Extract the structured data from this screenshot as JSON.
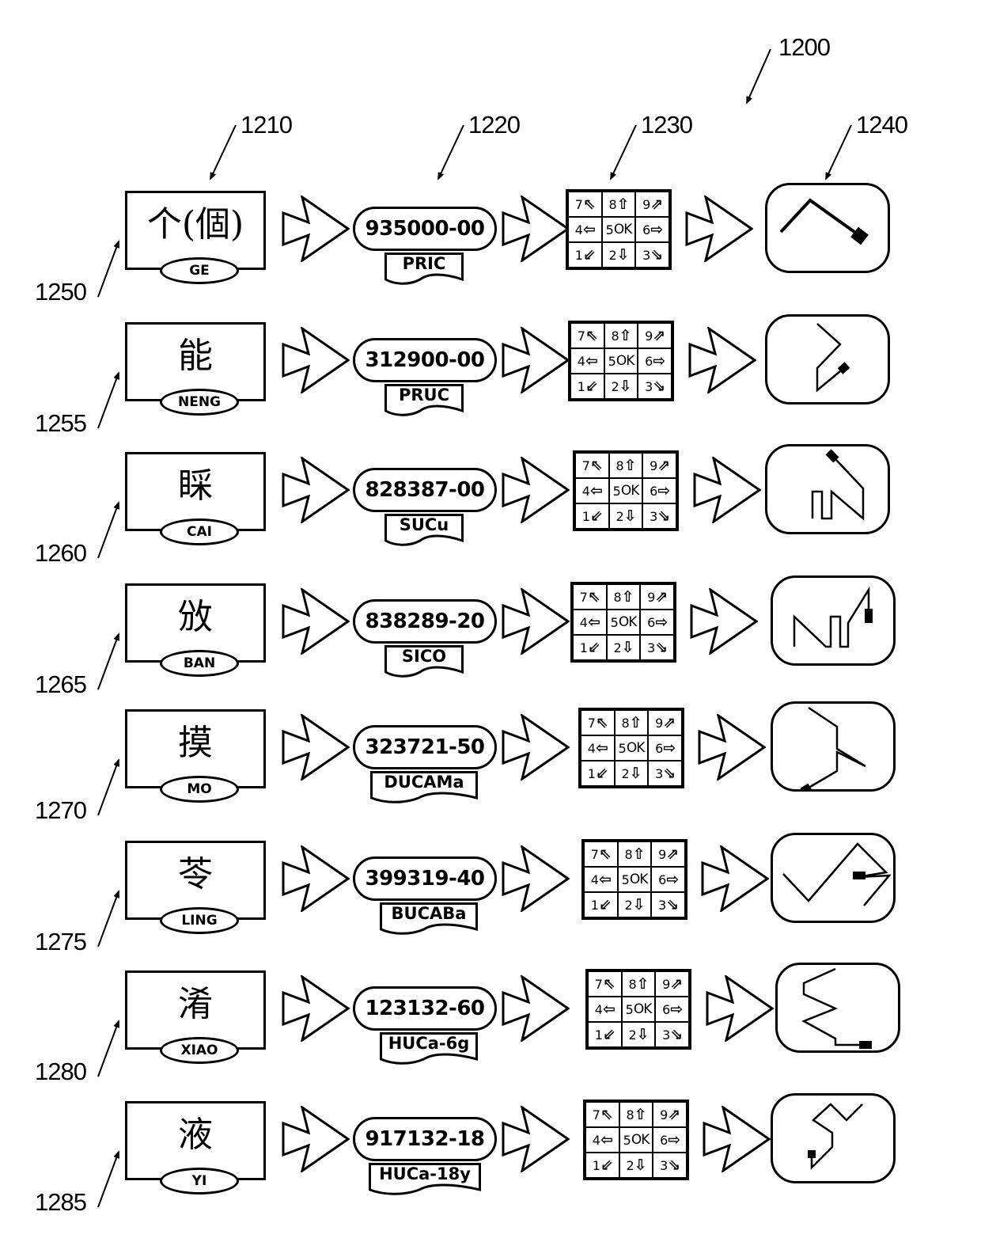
{
  "figure": {
    "ref": "1200",
    "column_refs": {
      "characters": "1210",
      "codes": "1220",
      "keypads": "1230",
      "gestures": "1240"
    }
  },
  "keypad_keys": [
    {
      "num": "7",
      "glyph": "⇖"
    },
    {
      "num": "8",
      "glyph": "⇧"
    },
    {
      "num": "9",
      "glyph": "⇗"
    },
    {
      "num": "4",
      "glyph": "⇦"
    },
    {
      "num": "5",
      "glyph": "OK"
    },
    {
      "num": "6",
      "glyph": "⇨"
    },
    {
      "num": "1",
      "glyph": "⇙"
    },
    {
      "num": "2",
      "glyph": "⇩"
    },
    {
      "num": "3",
      "glyph": "⇘"
    }
  ],
  "rows": [
    {
      "ref": "1250",
      "character": "个(個)",
      "pinyin": "GE",
      "code": "935000-00",
      "tag": "PRIC",
      "gesture": {
        "path": [
          [
            20,
            62
          ],
          [
            57,
            22
          ],
          [
            113,
            62
          ]
        ],
        "pad": [
          [
            113,
            62
          ],
          [
            126,
            72
          ]
        ]
      }
    },
    {
      "ref": "1255",
      "character": "能",
      "pinyin": "NENG",
      "code": "312900-00",
      "tag": "PRUC",
      "gesture": {
        "path": [
          [
            66,
            12
          ],
          [
            95,
            38
          ],
          [
            66,
            68
          ],
          [
            66,
            96
          ],
          [
            95,
            72
          ]
        ],
        "pad": [
          [
            95,
            72
          ],
          [
            104,
            64
          ]
        ]
      }
    },
    {
      "ref": "1260",
      "character": "睬",
      "pinyin": "CAI",
      "code": "828387-00",
      "tag": "SUCu",
      "gesture": {
        "path": [
          [
            60,
            94
          ],
          [
            60,
            60
          ],
          [
            72,
            60
          ],
          [
            72,
            94
          ],
          [
            84,
            94
          ],
          [
            84,
            60
          ],
          [
            124,
            94
          ],
          [
            124,
            56
          ],
          [
            90,
            20
          ]
        ],
        "pad": [
          [
            90,
            20
          ],
          [
            80,
            10
          ]
        ]
      }
    },
    {
      "ref": "1265",
      "character": "攽",
      "pinyin": "BAN",
      "code": "838289-20",
      "tag": "SICO",
      "gesture": {
        "path": [
          [
            30,
            90
          ],
          [
            30,
            52
          ],
          [
            70,
            90
          ],
          [
            76,
            90
          ],
          [
            76,
            52
          ],
          [
            88,
            52
          ],
          [
            88,
            90
          ],
          [
            98,
            90
          ],
          [
            98,
            60
          ],
          [
            124,
            18
          ],
          [
            124,
            42
          ]
        ],
        "pad": [
          [
            124,
            42
          ],
          [
            124,
            60
          ]
        ]
      }
    },
    {
      "ref": "1270",
      "character": "摸",
      "pinyin": "MO",
      "code": "323721-50",
      "tag": "DUCAMa",
      "gesture": {
        "path": [
          [
            48,
            8
          ],
          [
            84,
            32
          ],
          [
            84,
            60
          ],
          [
            120,
            82
          ],
          [
            84,
            64
          ],
          [
            84,
            88
          ],
          [
            50,
            108
          ]
        ],
        "pad": [
          [
            50,
            108
          ],
          [
            40,
            114
          ]
        ]
      }
    },
    {
      "ref": "1275",
      "character": "苓",
      "pinyin": "LING",
      "code": "399319-40",
      "tag": "BUCABa",
      "gesture": {
        "path": [
          [
            16,
            52
          ],
          [
            48,
            86
          ],
          [
            110,
            14
          ],
          [
            146,
            50
          ],
          [
            110,
            56
          ],
          [
            150,
            54
          ],
          [
            118,
            92
          ]
        ],
        "pad": [
          [
            104,
            54
          ],
          [
            120,
            54
          ]
        ]
      }
    },
    {
      "ref": "1280",
      "character": "淆",
      "pinyin": "XIAO",
      "code": "123132-60",
      "tag": "HUCa-6g",
      "gesture": {
        "path": [
          [
            76,
            8
          ],
          [
            36,
            26
          ],
          [
            36,
            40
          ],
          [
            76,
            58
          ],
          [
            36,
            74
          ],
          [
            76,
            96
          ],
          [
            76,
            104
          ],
          [
            106,
            104
          ]
        ],
        "pad": [
          [
            106,
            104
          ],
          [
            122,
            104
          ]
        ]
      }
    },
    {
      "ref": "1285",
      "character": "液",
      "pinyin": "YI",
      "code": "917132-18",
      "tag": "HUCa-18y",
      "gesture": {
        "path": [
          [
            52,
            82
          ],
          [
            52,
            94
          ],
          [
            78,
            68
          ],
          [
            78,
            50
          ],
          [
            54,
            34
          ],
          [
            76,
            14
          ],
          [
            96,
            34
          ],
          [
            116,
            14
          ]
        ],
        "pad": [
          [
            52,
            72
          ],
          [
            52,
            82
          ]
        ]
      }
    }
  ]
}
